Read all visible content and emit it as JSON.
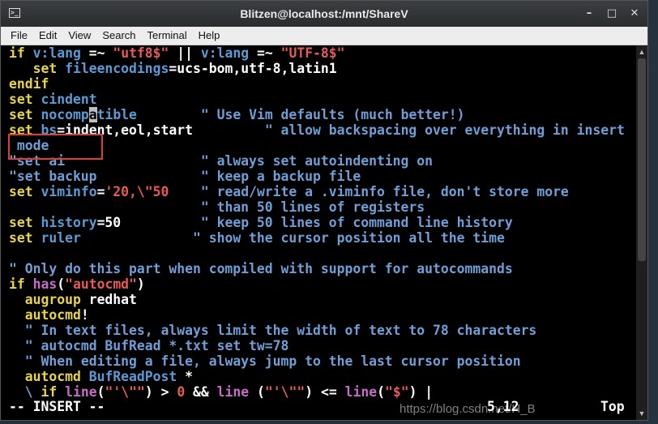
{
  "window": {
    "title": "Blitzen@localhost:/mnt/ShareV"
  },
  "menu": [
    "File",
    "Edit",
    "View",
    "Search",
    "Terminal",
    "Help"
  ],
  "lines": [
    [
      [
        "k",
        "if"
      ],
      [
        "w",
        " "
      ],
      [
        "v",
        "v:lang"
      ],
      [
        "w",
        " =~ "
      ],
      [
        "s",
        "\"utf8$\""
      ],
      [
        "w",
        " || "
      ],
      [
        "v",
        "v:lang"
      ],
      [
        "w",
        " =~ "
      ],
      [
        "s",
        "\"UTF-8$\""
      ]
    ],
    [
      [
        "w",
        "   "
      ],
      [
        "k",
        "set"
      ],
      [
        "w",
        " "
      ],
      [
        "v",
        "fileencodings"
      ],
      [
        "w",
        "=ucs-bom,utf-8,latin1"
      ]
    ],
    [
      [
        "k",
        "endif"
      ]
    ],
    [
      [
        "k",
        "set"
      ],
      [
        "w",
        " "
      ],
      [
        "v",
        "cindent"
      ]
    ],
    [
      [
        "k",
        "set"
      ],
      [
        "w",
        " "
      ],
      [
        "v",
        "nocomp"
      ],
      [
        "cur",
        "a"
      ],
      [
        "v",
        "tible"
      ],
      [
        "w",
        "        "
      ],
      [
        "c",
        "\" Use Vim defaults (much better!)"
      ]
    ],
    [
      [
        "k",
        "set"
      ],
      [
        "w",
        " "
      ],
      [
        "v",
        "bs"
      ],
      [
        "w",
        "=indent,eol,start         "
      ],
      [
        "c",
        "\" allow backspacing over everything in insert"
      ]
    ],
    [
      [
        "c",
        " mode"
      ]
    ],
    [
      [
        "c",
        "\"set ai"
      ],
      [
        "w",
        "                 "
      ],
      [
        "c",
        "\" always set autoindenting on"
      ]
    ],
    [
      [
        "c",
        "\"set backup"
      ],
      [
        "w",
        "             "
      ],
      [
        "c",
        "\" keep a backup file"
      ]
    ],
    [
      [
        "k",
        "set"
      ],
      [
        "w",
        " "
      ],
      [
        "v",
        "viminfo"
      ],
      [
        "w",
        "="
      ],
      [
        "s",
        "'20,\\\"50"
      ],
      [
        "w",
        "    "
      ],
      [
        "c",
        "\" read/write a .viminfo file, don't store more"
      ]
    ],
    [
      [
        "w",
        "                        "
      ],
      [
        "c",
        "\" than 50 lines of registers"
      ]
    ],
    [
      [
        "k",
        "set"
      ],
      [
        "w",
        " "
      ],
      [
        "v",
        "history"
      ],
      [
        "w",
        "=50          "
      ],
      [
        "c",
        "\" keep 50 lines of command line history"
      ]
    ],
    [
      [
        "k",
        "set"
      ],
      [
        "w",
        " "
      ],
      [
        "v",
        "ruler"
      ],
      [
        "w",
        "              "
      ],
      [
        "c",
        "\" show the cursor position all the time"
      ]
    ],
    [
      [
        "w",
        ""
      ]
    ],
    [
      [
        "c",
        "\" Only do this part when compiled with support for autocommands"
      ]
    ],
    [
      [
        "k",
        "if"
      ],
      [
        "w",
        " "
      ],
      [
        "a",
        "has"
      ],
      [
        "w",
        "("
      ],
      [
        "s",
        "\"autocmd\""
      ],
      [
        "w",
        ")"
      ]
    ],
    [
      [
        "w",
        "  "
      ],
      [
        "k",
        "augroup"
      ],
      [
        "w",
        " redhat"
      ]
    ],
    [
      [
        "w",
        "  "
      ],
      [
        "k",
        "autocmd"
      ],
      [
        "w",
        "!"
      ]
    ],
    [
      [
        "w",
        "  "
      ],
      [
        "c",
        "\" In text files, always limit the width of text to 78 characters"
      ]
    ],
    [
      [
        "w",
        "  "
      ],
      [
        "c",
        "\" autocmd BufRead *.txt set tw=78"
      ]
    ],
    [
      [
        "w",
        "  "
      ],
      [
        "c",
        "\" When editing a file, always jump to the last cursor position"
      ]
    ],
    [
      [
        "w",
        "  "
      ],
      [
        "k",
        "autocmd"
      ],
      [
        "w",
        " "
      ],
      [
        "v",
        "BufReadPost"
      ],
      [
        "w",
        " *"
      ]
    ],
    [
      [
        "w",
        "  "
      ],
      [
        "c",
        "\\"
      ],
      [
        "w",
        " "
      ],
      [
        "k",
        "if"
      ],
      [
        "w",
        " "
      ],
      [
        "a",
        "line"
      ],
      [
        "w",
        "("
      ],
      [
        "s",
        "\"'\\\"\""
      ],
      [
        "w",
        ") > "
      ],
      [
        "s",
        "0"
      ],
      [
        "w",
        " && "
      ],
      [
        "a",
        "line"
      ],
      [
        "w",
        " ("
      ],
      [
        "s",
        "\"'\\\"\""
      ],
      [
        "w",
        ") <= "
      ],
      [
        "a",
        "line"
      ],
      [
        "w",
        "("
      ],
      [
        "s",
        "\"$\""
      ],
      [
        "w",
        ") |"
      ]
    ]
  ],
  "status": {
    "mode": "-- INSERT --",
    "position": "5,12",
    "scroll": "Top"
  },
  "watermark": "https://blog.csdn.net/H_B",
  "colors": {
    "keyword": "#e7d34c",
    "variable": "#5b9bd5",
    "string": "#e85a58",
    "comment": "#6f9fd6",
    "highlight": "#e23b3b"
  },
  "icons": {
    "terminal": "terminal-icon",
    "minimize": "minimize-icon",
    "maximize": "maximize-icon",
    "close": "close-icon"
  }
}
